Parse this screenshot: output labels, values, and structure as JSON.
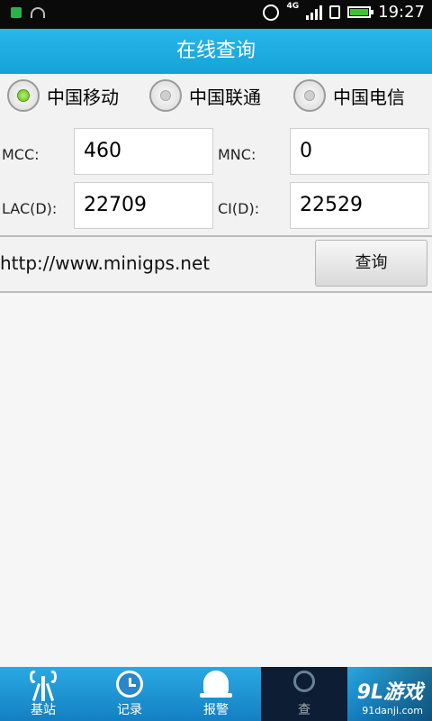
{
  "status_bar": {
    "network": "4G",
    "time": "19:27",
    "colors": {
      "battery": "#3ec232"
    }
  },
  "title": "在线查询",
  "operators": [
    {
      "label": "中国移动",
      "checked": true
    },
    {
      "label": "中国联通",
      "checked": false
    },
    {
      "label": "中国电信",
      "checked": false
    }
  ],
  "form": {
    "mcc_label": "MCC:",
    "mcc_value": "460",
    "mnc_label": "MNC:",
    "mnc_value": "0",
    "lac_label": "LAC(D):",
    "lac_value": "22709",
    "ci_label": "CI(D):",
    "ci_value": "22529"
  },
  "url_text": "http://www.minigps.net",
  "query_button": "查询",
  "tabs": [
    {
      "label": "基站",
      "icon": "tower-icon"
    },
    {
      "label": "记录",
      "icon": "clock-icon"
    },
    {
      "label": "报警",
      "icon": "bell-icon"
    },
    {
      "label": "查",
      "icon": "search-icon",
      "active": true
    }
  ],
  "watermark": {
    "main": "9L游戏",
    "sub": "91danji.com"
  },
  "colors": {
    "accent": "#1ba8e0",
    "nav_active": "#0d1e34"
  }
}
